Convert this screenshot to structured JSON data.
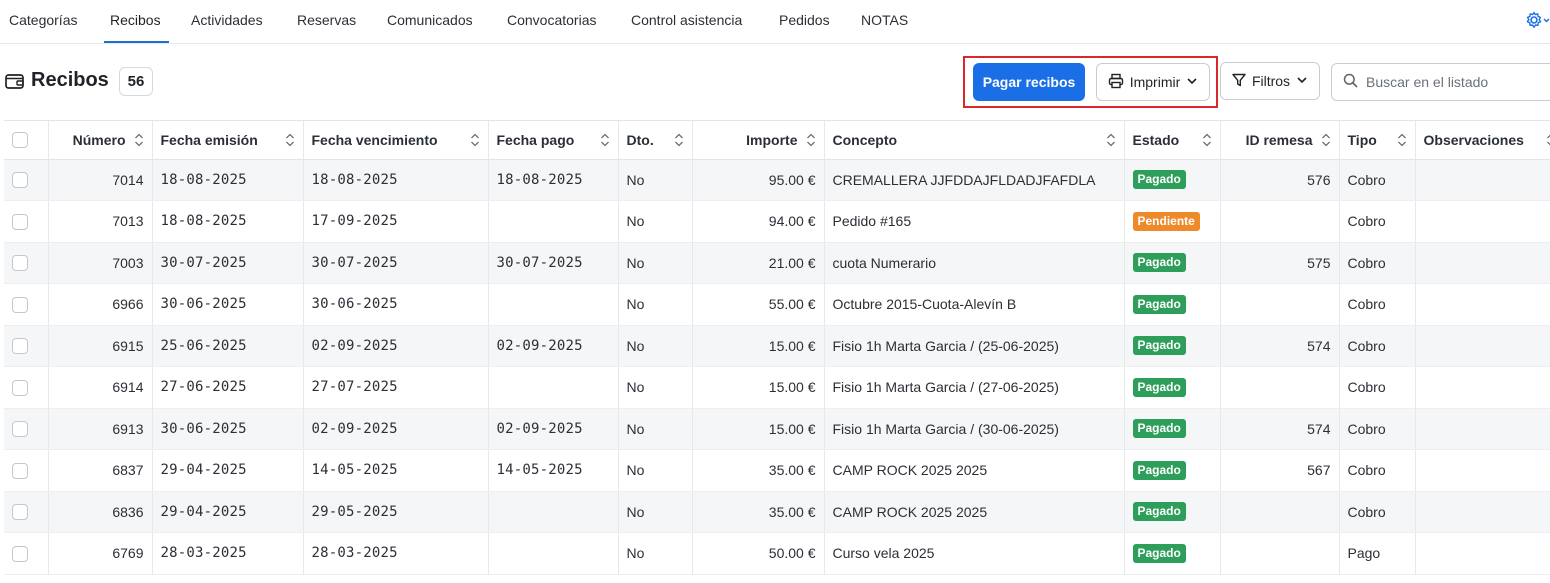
{
  "tabs": [
    {
      "label": "Categorías",
      "active": false
    },
    {
      "label": "Recibos",
      "active": true
    },
    {
      "label": "Actividades",
      "active": false
    },
    {
      "label": "Reservas",
      "active": false
    },
    {
      "label": "Comunicados",
      "active": false
    },
    {
      "label": "Convocatorias",
      "active": false
    },
    {
      "label": "Control asistencia",
      "active": false
    },
    {
      "label": "Pedidos",
      "active": false
    },
    {
      "label": "NOTAS",
      "active": false
    }
  ],
  "header": {
    "title": "Recibos",
    "count": "56",
    "icon": "wallet-icon"
  },
  "toolbar": {
    "pay_label": "Pagar recibos",
    "print_label": "Imprimir",
    "filter_label": "Filtros",
    "search_placeholder": "Buscar en el listado",
    "search_value": ""
  },
  "table": {
    "columns": [
      "Número",
      "Fecha emisión",
      "Fecha vencimiento",
      "Fecha pago",
      "Dto.",
      "Importe",
      "Concepto",
      "Estado",
      "ID remesa",
      "Tipo",
      "Observaciones"
    ],
    "rows": [
      {
        "numero": "7014",
        "emision": "18-08-2025",
        "vencimiento": "18-08-2025",
        "pago": "18-08-2025",
        "dto": "No",
        "importe": "95.00 €",
        "concepto": "CREMALLERA JJFDDAJFLDADJFAFDLA",
        "estado": "Pagado",
        "remesa": "576",
        "tipo": "Cobro",
        "obs": ""
      },
      {
        "numero": "7013",
        "emision": "18-08-2025",
        "vencimiento": "17-09-2025",
        "pago": "",
        "dto": "No",
        "importe": "94.00 €",
        "concepto": "Pedido #165",
        "estado": "Pendiente",
        "remesa": "",
        "tipo": "Cobro",
        "obs": ""
      },
      {
        "numero": "7003",
        "emision": "30-07-2025",
        "vencimiento": "30-07-2025",
        "pago": "30-07-2025",
        "dto": "No",
        "importe": "21.00 €",
        "concepto": "cuota Numerario",
        "estado": "Pagado",
        "remesa": "575",
        "tipo": "Cobro",
        "obs": ""
      },
      {
        "numero": "6966",
        "emision": "30-06-2025",
        "vencimiento": "30-06-2025",
        "pago": "",
        "dto": "No",
        "importe": "55.00 €",
        "concepto": "Octubre 2015-Cuota-Alevín B",
        "estado": "Pagado",
        "remesa": "",
        "tipo": "Cobro",
        "obs": ""
      },
      {
        "numero": "6915",
        "emision": "25-06-2025",
        "vencimiento": "02-09-2025",
        "pago": "02-09-2025",
        "dto": "No",
        "importe": "15.00 €",
        "concepto": "Fisio 1h Marta Garcia / (25-06-2025)",
        "estado": "Pagado",
        "remesa": "574",
        "tipo": "Cobro",
        "obs": ""
      },
      {
        "numero": "6914",
        "emision": "27-06-2025",
        "vencimiento": "27-07-2025",
        "pago": "",
        "dto": "No",
        "importe": "15.00 €",
        "concepto": "Fisio 1h Marta Garcia / (27-06-2025)",
        "estado": "Pagado",
        "remesa": "",
        "tipo": "Cobro",
        "obs": ""
      },
      {
        "numero": "6913",
        "emision": "30-06-2025",
        "vencimiento": "02-09-2025",
        "pago": "02-09-2025",
        "dto": "No",
        "importe": "15.00 €",
        "concepto": "Fisio 1h Marta Garcia / (30-06-2025)",
        "estado": "Pagado",
        "remesa": "574",
        "tipo": "Cobro",
        "obs": ""
      },
      {
        "numero": "6837",
        "emision": "29-04-2025",
        "vencimiento": "14-05-2025",
        "pago": "14-05-2025",
        "dto": "No",
        "importe": "35.00 €",
        "concepto": "CAMP ROCK 2025 2025",
        "estado": "Pagado",
        "remesa": "567",
        "tipo": "Cobro",
        "obs": ""
      },
      {
        "numero": "6836",
        "emision": "29-04-2025",
        "vencimiento": "29-05-2025",
        "pago": "",
        "dto": "No",
        "importe": "35.00 €",
        "concepto": "CAMP ROCK 2025 2025",
        "estado": "Pagado",
        "remesa": "",
        "tipo": "Cobro",
        "obs": ""
      },
      {
        "numero": "6769",
        "emision": "28-03-2025",
        "vencimiento": "28-03-2025",
        "pago": "",
        "dto": "No",
        "importe": "50.00 €",
        "concepto": "Curso vela 2025",
        "estado": "Pagado",
        "remesa": "",
        "tipo": "Pago",
        "obs": ""
      }
    ]
  },
  "colors": {
    "accent": "#1a6fe6",
    "paid": "#2e9e5b",
    "pending": "#ef8a2b",
    "highlight": "#d9272e"
  }
}
